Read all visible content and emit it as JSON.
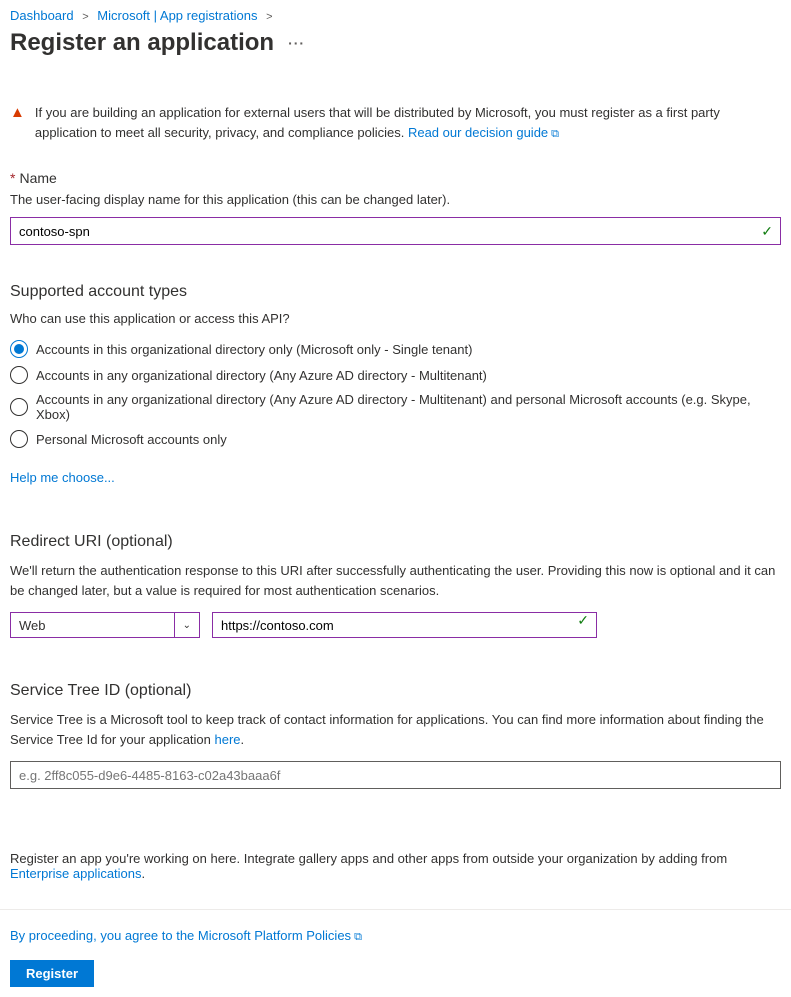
{
  "breadcrumb": {
    "items": [
      "Dashboard",
      "Microsoft | App registrations"
    ],
    "sep": ">"
  },
  "page": {
    "title": "Register an application",
    "more": "···"
  },
  "warning": {
    "text": "If you are building an application for external users that will be distributed by Microsoft, you must register as a first party application to meet all security, privacy, and compliance policies. ",
    "link": "Read our decision guide"
  },
  "name": {
    "label": "Name",
    "desc": "The user-facing display name for this application (this can be changed later).",
    "value": "contoso-spn"
  },
  "account_types": {
    "header": "Supported account types",
    "question": "Who can use this application or access this API?",
    "options": [
      "Accounts in this organizational directory only (Microsoft only - Single tenant)",
      "Accounts in any organizational directory (Any Azure AD directory - Multitenant)",
      "Accounts in any organizational directory (Any Azure AD directory - Multitenant) and personal Microsoft accounts (e.g. Skype, Xbox)",
      "Personal Microsoft accounts only"
    ],
    "selected": 0,
    "help": "Help me choose..."
  },
  "redirect": {
    "header": "Redirect URI (optional)",
    "desc": "We'll return the authentication response to this URI after successfully authenticating the user. Providing this now is optional and it can be changed later, but a value is required for most authentication scenarios.",
    "platform": "Web",
    "uri": "https://contoso.com"
  },
  "service_tree": {
    "header": "Service Tree ID (optional)",
    "desc_pre": "Service Tree is a Microsoft tool to keep track of contact information for applications. You can find more information about finding the Service Tree Id for your application ",
    "desc_link": "here",
    "desc_post": ".",
    "placeholder": "e.g. 2ff8c055-d9e6-4485-8163-c02a43baaa6f"
  },
  "footer": {
    "text_pre": "Register an app you're working on here. Integrate gallery apps and other apps from outside your organization by adding from ",
    "text_link": "Enterprise applications",
    "text_post": ".",
    "proceed": "By proceeding, you agree to the Microsoft Platform Policies",
    "register": "Register"
  }
}
